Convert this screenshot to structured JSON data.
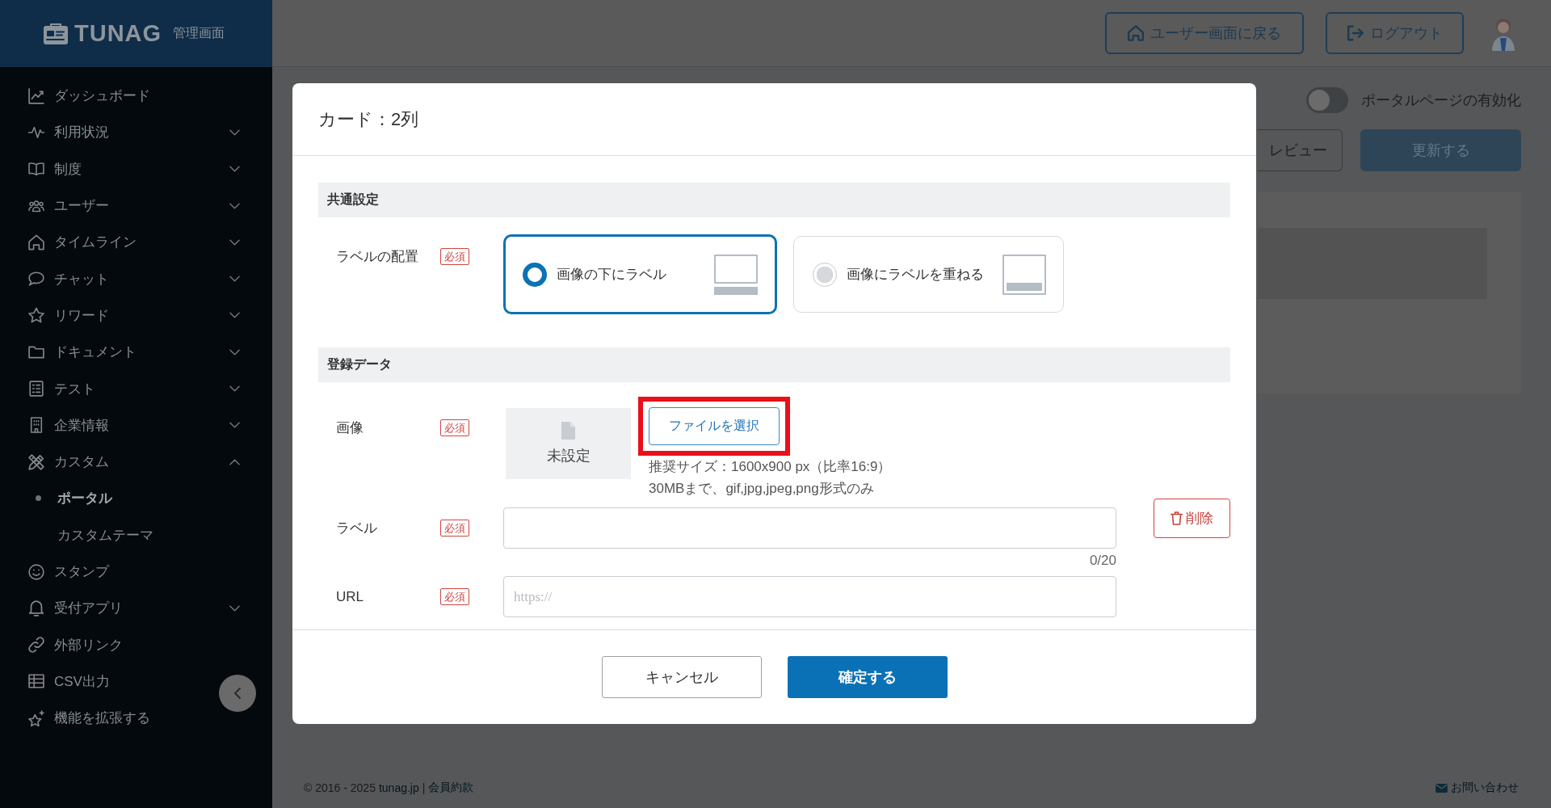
{
  "sidebar": {
    "brand": {
      "name": "TUNAG",
      "subtitle": "管理画面"
    },
    "items": [
      {
        "label": "ダッシュボード",
        "kind": "link"
      },
      {
        "label": "利用状況",
        "kind": "group",
        "expanded": false
      },
      {
        "label": "制度",
        "kind": "group",
        "expanded": false
      },
      {
        "label": "ユーザー",
        "kind": "group",
        "expanded": false
      },
      {
        "label": "タイムライン",
        "kind": "group",
        "expanded": false
      },
      {
        "label": "チャット",
        "kind": "group",
        "expanded": false
      },
      {
        "label": "リワード",
        "kind": "group",
        "expanded": false
      },
      {
        "label": "ドキュメント",
        "kind": "group",
        "expanded": false
      },
      {
        "label": "テスト",
        "kind": "group",
        "expanded": false
      },
      {
        "label": "企業情報",
        "kind": "group",
        "expanded": false
      },
      {
        "label": "カスタム",
        "kind": "group",
        "expanded": true,
        "children": [
          {
            "label": "ポータル",
            "selected": true
          },
          {
            "label": "カスタムテーマ",
            "selected": false
          }
        ]
      },
      {
        "label": "スタンプ",
        "kind": "link"
      },
      {
        "label": "受付アプリ",
        "kind": "group",
        "expanded": false
      },
      {
        "label": "外部リンク",
        "kind": "link"
      },
      {
        "label": "CSV出力",
        "kind": "link"
      },
      {
        "label": "機能を拡張する",
        "kind": "link"
      }
    ]
  },
  "top_bar": {
    "buttons": [
      {
        "label": "ユーザー画面に戻る"
      },
      {
        "label": "ログアウト"
      }
    ]
  },
  "page": {
    "toggle": {
      "label": "ポータルページの有効化",
      "on": false
    },
    "preview_button": {
      "label": "レビュー"
    },
    "update_button": {
      "label": "更新する",
      "disabled": true
    }
  },
  "modal": {
    "title": "カード：2列",
    "sections": [
      {
        "title": "共通設定",
        "fields": [
          {
            "kind": "choice",
            "label": "ラベルの配置",
            "badge": "必須",
            "options": [
              {
                "label": "画像の下にラベル",
                "selected": true
              },
              {
                "label": "画像にラベルを重ねる",
                "selected": false
              }
            ]
          }
        ]
      },
      {
        "title": "登録データ",
        "fields": [
          {
            "kind": "image",
            "label": "画像",
            "badge": "必須",
            "preview": "未設定",
            "button": {
              "label": "ファイルを選択",
              "highlighted": true
            },
            "hints": [
              "推奨サイズ：1600x900 px（比率16:9）",
              "30MBまで、gif,jpg,jpeg,png形式のみ"
            ]
          },
          {
            "kind": "text",
            "label": "ラベル",
            "badge": "必須",
            "action": {
              "label": "削除"
            },
            "counter": "0/20"
          },
          {
            "kind": "text",
            "label": "URL",
            "badge": "必須",
            "placeholder": "https://"
          }
        ]
      }
    ],
    "buttons": [
      {
        "label": "キャンセル",
        "kind": "secondary"
      },
      {
        "label": "確定する",
        "kind": "primary"
      }
    ]
  },
  "footer": {
    "copyright": "© 2016 - 2025",
    "site_link": "tunag.jp",
    "separator": "|",
    "terms_link": "会員約款",
    "contact_link": "お問い合わせ"
  }
}
